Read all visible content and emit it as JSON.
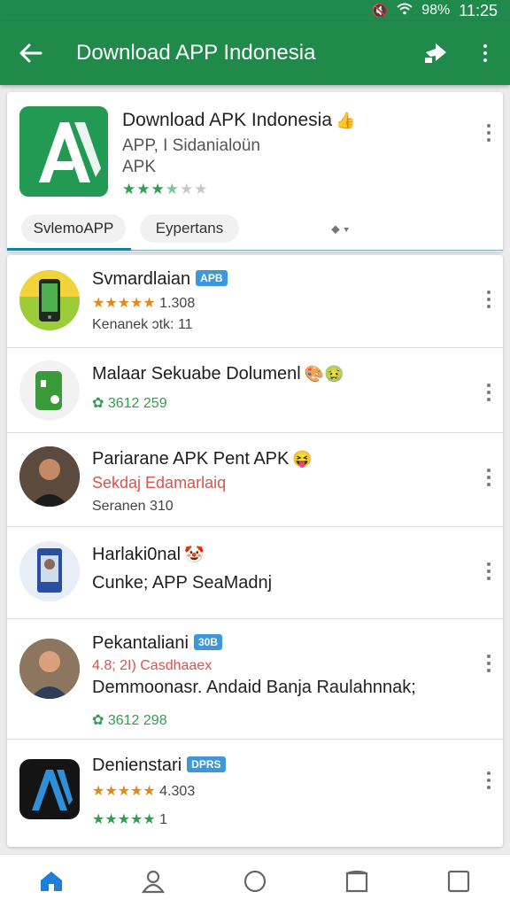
{
  "status_bar": {
    "battery": "98%",
    "time": "11:25"
  },
  "app_bar": {
    "title": "Download APP Indonesia"
  },
  "hero": {
    "name": "Download APK Indonesia",
    "emoji": "👍",
    "subtitle_1": "APP, I Sidanialoün",
    "subtitle_2": "APK",
    "rating_stars": "3.5 of 5 stars"
  },
  "tabs": [
    {
      "label": "SvlemoAPP"
    },
    {
      "label": "Eypertans"
    }
  ],
  "list": [
    {
      "title": "Svmardlaian",
      "badge": "APB",
      "stars": "★★★★★",
      "rating": "1.308",
      "line3": "Kenanek ɔtk: 11"
    },
    {
      "title": "Malaar Sekuabe Dolumenl",
      "emoji": "🎨🤢",
      "line2": "3612 259"
    },
    {
      "title": "Pariarane APK Pent APK",
      "emoji": "😝",
      "line2": "Sekdaj Edamarlaiq",
      "line3": "Seranen 310"
    },
    {
      "title": "Harlaki0nal",
      "emoji": "🤡",
      "line2": "Cunke; APP SeaMadnj"
    },
    {
      "title": "Pekantaliani",
      "badge": "30B",
      "line2": "4.8; 2I) Casdhaaex",
      "line3": "Demmoonasr. Andaid Banja Raulahnnak;",
      "line4": "3612 298"
    },
    {
      "title": "Denienstari",
      "badge": "DPRS",
      "stars": "★★★★★",
      "rating": "4.303",
      "line3_stars": "★★★★★",
      "line3_count": "1"
    }
  ]
}
